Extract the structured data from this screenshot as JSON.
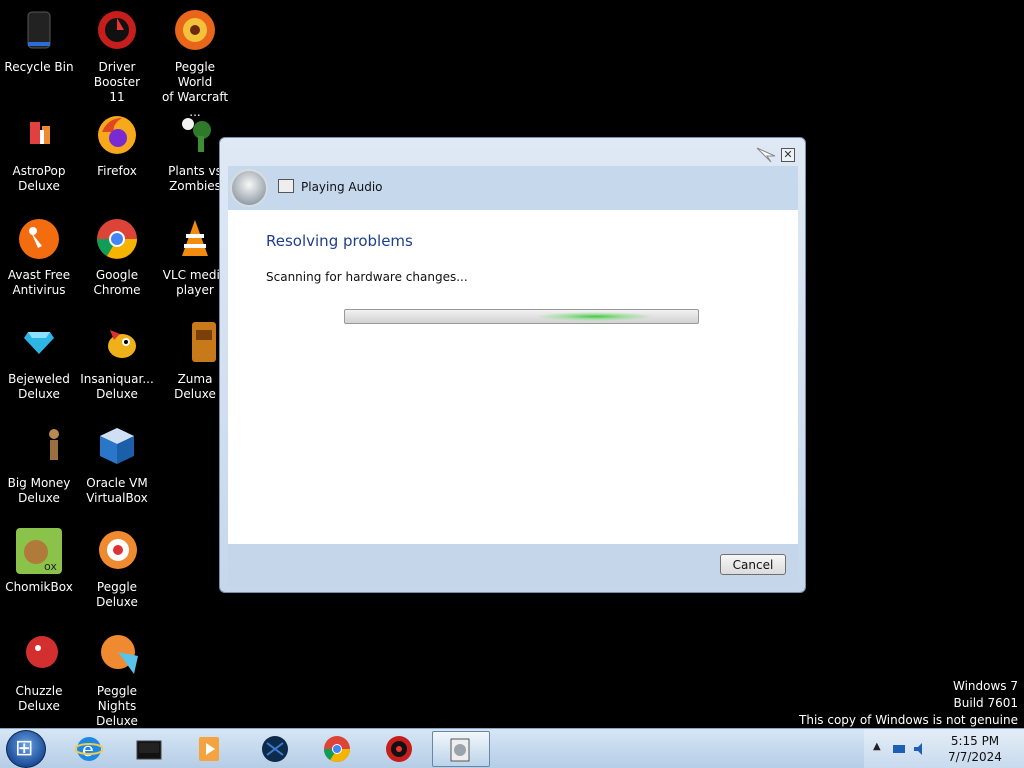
{
  "desktop": {
    "icons": [
      {
        "label": "Recycle Bin",
        "icon": "recycle-bin-icon"
      },
      {
        "label": "Driver Booster\n11",
        "icon": "driver-booster-icon"
      },
      {
        "label": "Peggle World\nof Warcraft ...",
        "icon": "peggle-wow-icon"
      },
      {
        "label": "AstroPop\nDeluxe",
        "icon": "astropop-icon"
      },
      {
        "label": "Firefox",
        "icon": "firefox-icon"
      },
      {
        "label": "Plants vs\nZombies",
        "icon": "plants-vs-zombies-icon"
      },
      {
        "label": "Avast Free\nAntivirus",
        "icon": "avast-icon"
      },
      {
        "label": "Google\nChrome",
        "icon": "chrome-icon"
      },
      {
        "label": "VLC media\nplayer",
        "icon": "vlc-icon"
      },
      {
        "label": "Bejeweled\nDeluxe",
        "icon": "bejeweled-icon"
      },
      {
        "label": "Insaniquar...\nDeluxe",
        "icon": "insaniquarium-icon"
      },
      {
        "label": "Zuma Deluxe",
        "icon": "zuma-icon"
      },
      {
        "label": "Big Money\nDeluxe",
        "icon": "big-money-icon"
      },
      {
        "label": "Oracle VM\nVirtualBox",
        "icon": "virtualbox-icon"
      },
      {
        "label": "ChomikBox",
        "icon": "chomikbox-icon"
      },
      {
        "label": "Peggle Deluxe",
        "icon": "peggle-deluxe-icon"
      },
      {
        "label": "Chuzzle\nDeluxe",
        "icon": "chuzzle-icon"
      },
      {
        "label": "Peggle Nights\nDeluxe",
        "icon": "peggle-nights-icon"
      }
    ]
  },
  "dialog": {
    "header_title": "Playing Audio",
    "body_title": "Resolving problems",
    "status": "Scanning for hardware changes...",
    "progress_state": "indeterminate",
    "cancel_label": "Cancel",
    "close_glyph": "✕"
  },
  "watermark": {
    "line1": "Windows 7",
    "line2": "Build 7601",
    "line3": "This copy of Windows is not genuine"
  },
  "taskbar": {
    "items": [
      "internet-explorer-icon",
      "windows-media-center-icon",
      "media-player-icon",
      "dark-app-icon",
      "chrome-icon",
      "driver-booster-icon",
      "troubleshooter-icon"
    ],
    "tray_arrow": "▲",
    "time": "5:15 PM",
    "date": "7/7/2024"
  },
  "colors": {
    "accent": "#1e3f8a",
    "progress_glow": "#46c846",
    "taskbar": "#c5d8ec"
  }
}
